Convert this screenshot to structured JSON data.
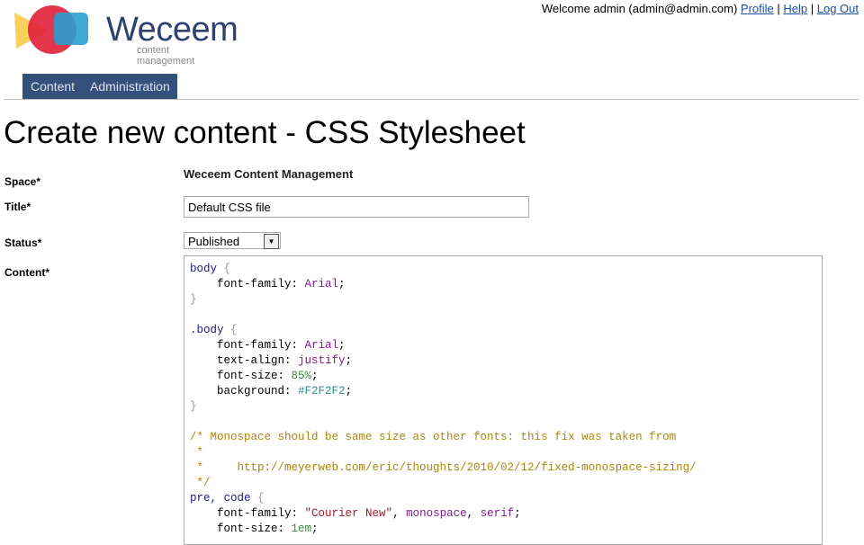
{
  "header": {
    "logo_text": "Weceem",
    "logo_sub": "content management",
    "welcome": "Welcome admin (admin@admin.com)",
    "links": [
      "Profile",
      "Help",
      "Log Out"
    ]
  },
  "nav": [
    "Content",
    "Administration"
  ],
  "page_title": "Create new content - CSS Stylesheet",
  "form": {
    "space_label": "Space*",
    "space_value": "Weceem Content Management",
    "title_label": "Title*",
    "title_value": "Default CSS file",
    "status_label": "Status*",
    "status_value": "Published",
    "content_label": "Content*"
  },
  "code_lines": [
    [
      [
        "sel",
        "body"
      ],
      [
        "br",
        " {"
      ]
    ],
    [
      [
        "prop",
        "    font-family: "
      ],
      [
        "val",
        "Arial"
      ],
      [
        "p",
        ";"
      ]
    ],
    [
      [
        "br",
        "}"
      ]
    ],
    [],
    [
      [
        "sel",
        ".body"
      ],
      [
        "br",
        " {"
      ]
    ],
    [
      [
        "prop",
        "    font-family: "
      ],
      [
        "val",
        "Arial"
      ],
      [
        "p",
        ";"
      ]
    ],
    [
      [
        "prop",
        "    text-align: "
      ],
      [
        "val",
        "justify"
      ],
      [
        "p",
        ";"
      ]
    ],
    [
      [
        "prop",
        "    font-size: "
      ],
      [
        "num",
        "85%"
      ],
      [
        "p",
        ";"
      ]
    ],
    [
      [
        "prop",
        "    background: "
      ],
      [
        "hex",
        "#F2F2F2"
      ],
      [
        "p",
        ";"
      ]
    ],
    [
      [
        "br",
        "}"
      ]
    ],
    [],
    [
      [
        "cm",
        "/* Monospace should be same size as other fonts: this fix was taken from"
      ]
    ],
    [
      [
        "cm",
        " *"
      ]
    ],
    [
      [
        "cm",
        " *     http://meyerweb.com/eric/thoughts/2010/02/12/fixed-monospace-sizing/"
      ]
    ],
    [
      [
        "cm",
        " */"
      ]
    ],
    [
      [
        "sel",
        "pre, code"
      ],
      [
        "br",
        " {"
      ]
    ],
    [
      [
        "prop",
        "    font-family: "
      ],
      [
        "str",
        "\"Courier New\""
      ],
      [
        "p",
        ", "
      ],
      [
        "val",
        "monospace"
      ],
      [
        "p",
        ", "
      ],
      [
        "val",
        "serif"
      ],
      [
        "p",
        ";"
      ]
    ],
    [
      [
        "prop",
        "    font-size: "
      ],
      [
        "num",
        "1em"
      ],
      [
        "p",
        ";"
      ]
    ]
  ]
}
